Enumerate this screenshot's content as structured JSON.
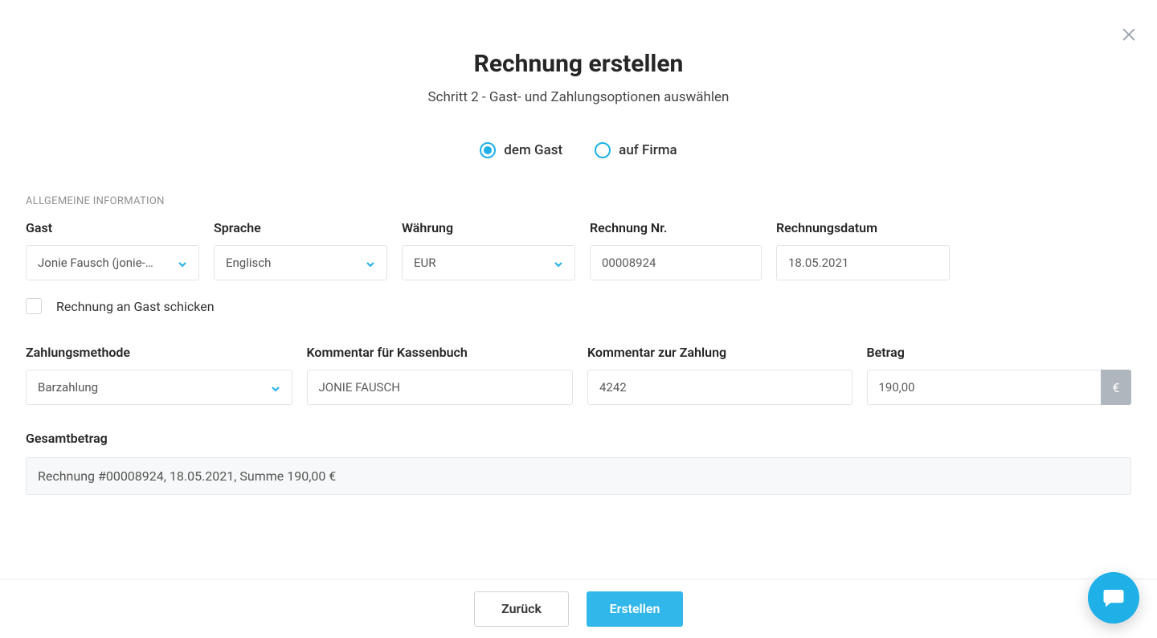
{
  "header": {
    "title": "Rechnung erstellen",
    "subtitle": "Schritt 2 - Gast- und Zahlungsoptionen auswählen"
  },
  "invoice_target": {
    "guest_label": "dem Gast",
    "company_label": "auf Firma",
    "selected": "guest"
  },
  "section_general": "ALLGEMEINE INFORMATION",
  "fields": {
    "guest": {
      "label": "Gast",
      "value": "Jonie Fausch (jonie-fau…"
    },
    "language": {
      "label": "Sprache",
      "value": "Englisch"
    },
    "currency": {
      "label": "Währung",
      "value": "EUR"
    },
    "inv_num": {
      "label": "Rechnung Nr.",
      "value": "00008924"
    },
    "inv_date": {
      "label": "Rechnungsdatum",
      "value": "18.05.2021"
    },
    "send_to_guest": {
      "label": "Rechnung an Gast schicken",
      "checked": false
    },
    "method": {
      "label": "Zahlungsmethode",
      "value": "Barzahlung"
    },
    "cashbook": {
      "label": "Kommentar für Kassenbuch",
      "value": "JONIE FAUSCH"
    },
    "paycomment": {
      "label": "Kommentar zur Zahlung",
      "value": "4242"
    },
    "amount": {
      "label": "Betrag",
      "value": "190,00",
      "currency": "€"
    }
  },
  "total": {
    "label": "Gesamtbetrag",
    "summary": "Rechnung #00008924, 18.05.2021, Summe 190,00 €"
  },
  "footer": {
    "back": "Zurück",
    "create": "Erstellen"
  }
}
